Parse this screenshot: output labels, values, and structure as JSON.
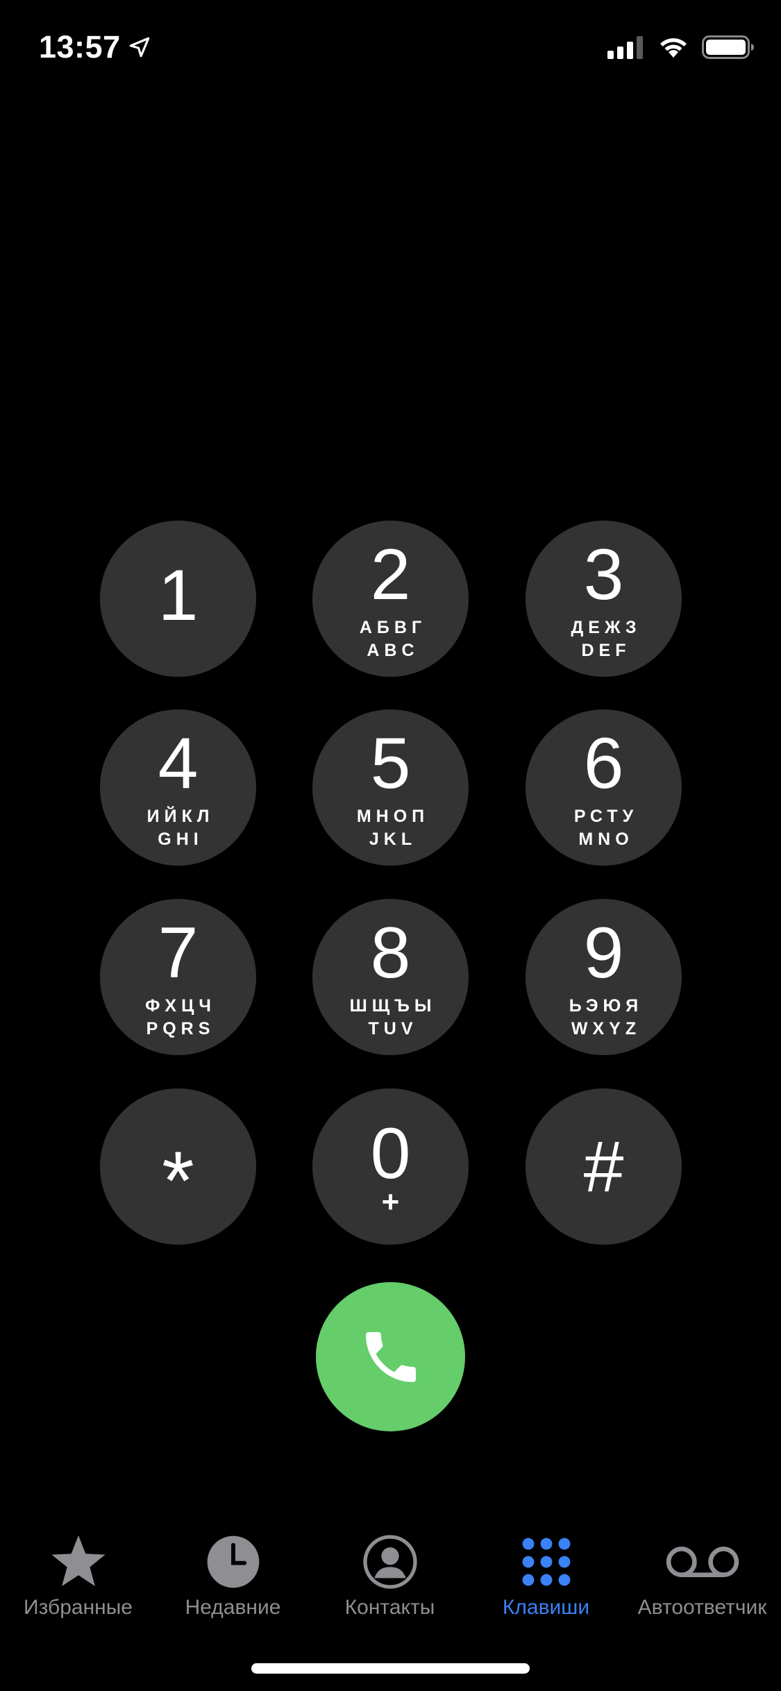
{
  "status_bar": {
    "time": "13:57",
    "location_icon": "location-arrow-icon",
    "signal_icon": "cellular-signal-icon",
    "wifi_icon": "wifi-icon",
    "battery_icon": "battery-icon"
  },
  "keypad": {
    "keys": [
      {
        "digit": "1",
        "letters_ru": "",
        "letters_en": ""
      },
      {
        "digit": "2",
        "letters_ru": "АБВГ",
        "letters_en": "ABC"
      },
      {
        "digit": "3",
        "letters_ru": "ДЕЖЗ",
        "letters_en": "DEF"
      },
      {
        "digit": "4",
        "letters_ru": "ИЙКЛ",
        "letters_en": "GHI"
      },
      {
        "digit": "5",
        "letters_ru": "МНОП",
        "letters_en": "JKL"
      },
      {
        "digit": "6",
        "letters_ru": "РСТУ",
        "letters_en": "MNO"
      },
      {
        "digit": "7",
        "letters_ru": "ФХЦЧ",
        "letters_en": "PQRS"
      },
      {
        "digit": "8",
        "letters_ru": "ШЩЪЫ",
        "letters_en": "TUV"
      },
      {
        "digit": "9",
        "letters_ru": "ЬЭЮЯ",
        "letters_en": "WXYZ"
      },
      {
        "digit": "*",
        "letters_ru": "",
        "letters_en": ""
      },
      {
        "digit": "0",
        "letters_ru": "+",
        "letters_en": ""
      },
      {
        "digit": "#",
        "letters_ru": "",
        "letters_en": ""
      }
    ]
  },
  "call_button": {
    "icon": "phone-icon",
    "color": "#65cd6a"
  },
  "tab_bar": {
    "active_color": "#3a82f6",
    "inactive_color": "#8e8e93",
    "tabs": [
      {
        "label": "Избранные",
        "icon": "star-icon",
        "active": false
      },
      {
        "label": "Недавние",
        "icon": "clock-icon",
        "active": false
      },
      {
        "label": "Контакты",
        "icon": "contact-icon",
        "active": false
      },
      {
        "label": "Клавиши",
        "icon": "keypad-icon",
        "active": true
      },
      {
        "label": "Автоответчик",
        "icon": "voicemail-icon",
        "active": false
      }
    ]
  }
}
